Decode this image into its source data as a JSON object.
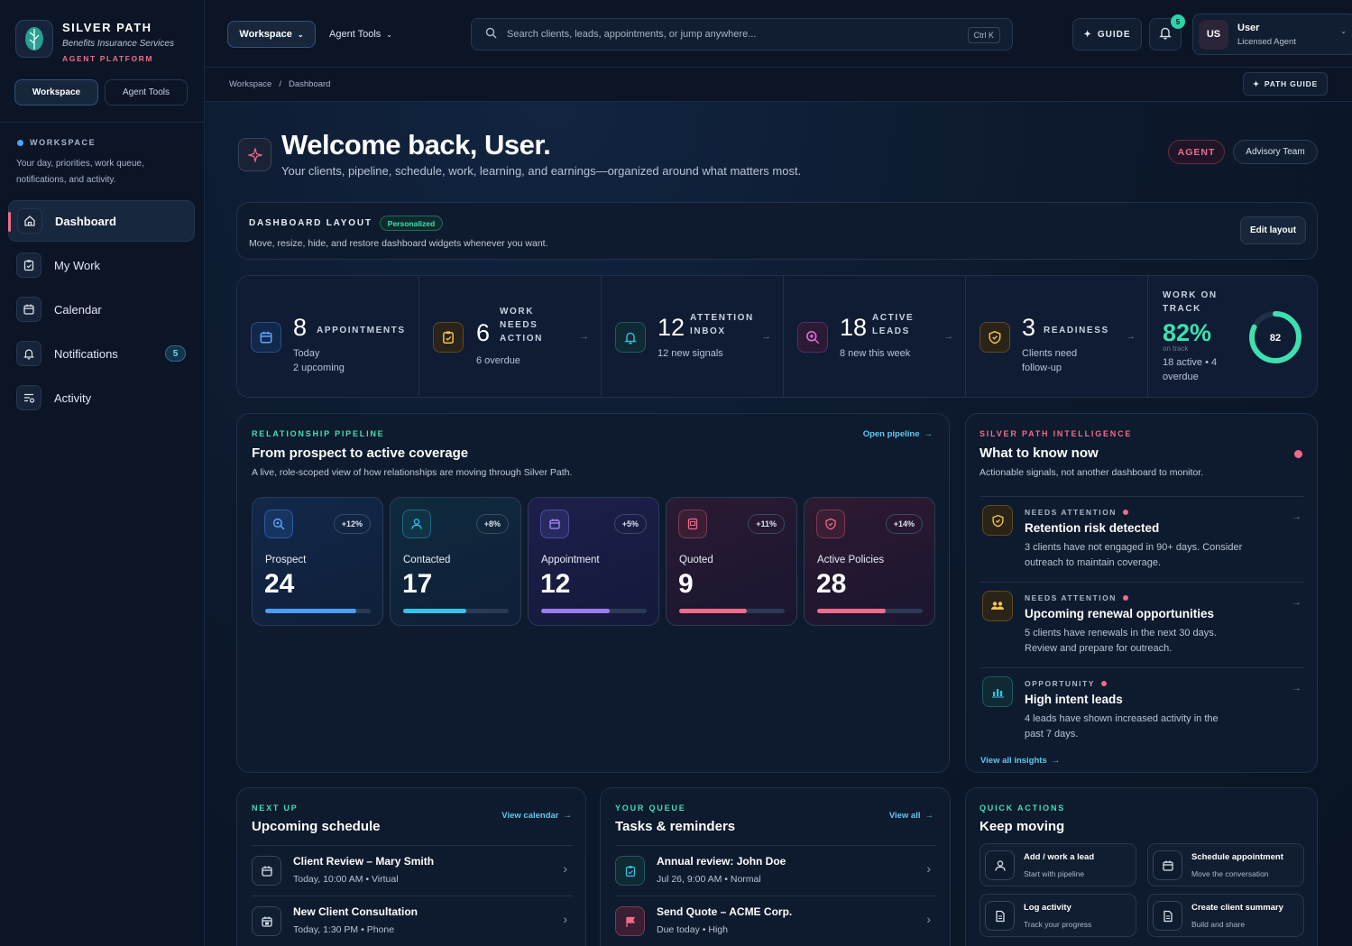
{
  "brand": {
    "name": "SILVER PATH",
    "tagline": "Benefits Insurance Services",
    "platform": "AGENT PLATFORM"
  },
  "sidebar": {
    "tabs": [
      {
        "label": "Workspace"
      },
      {
        "label": "Agent Tools"
      }
    ],
    "section_title": "WORKSPACE",
    "section_desc": "Your day, priorities, work queue, notifications, and activity.",
    "items": [
      {
        "label": "Dashboard",
        "icon": "home-icon"
      },
      {
        "label": "My Work",
        "icon": "clipboard-icon"
      },
      {
        "label": "Calendar",
        "icon": "calendar-icon"
      },
      {
        "label": "Notifications",
        "icon": "bell-icon",
        "badge": "5"
      },
      {
        "label": "Activity",
        "icon": "activity-icon"
      }
    ]
  },
  "topbar": {
    "workspace_label": "Workspace",
    "agent_tools_label": "Agent Tools",
    "search_placeholder": "Search clients, leads, appointments, or jump anywhere...",
    "search_shortcut": "Ctrl K",
    "guide_label": "GUIDE",
    "notif_count": "5",
    "user": {
      "initials": "US",
      "name": "User",
      "role": "Licensed Agent"
    }
  },
  "breadcrumb": {
    "root": "Workspace",
    "sep": "/",
    "current": "Dashboard",
    "path_guide": "PATH GUIDE"
  },
  "welcome": {
    "title": "Welcome back, User.",
    "subtitle": "Your clients, pipeline, schedule, work, learning, and earnings—organized around what matters most.",
    "tag_agent": "AGENT",
    "tag_team": "Advisory Team"
  },
  "layout_panel": {
    "title": "DASHBOARD LAYOUT",
    "badge": "Personalized",
    "desc": "Move, resize, hide, and restore dashboard widgets whenever you want.",
    "edit": "Edit layout"
  },
  "stats": [
    {
      "num": "8",
      "label": "APPOINTMENTS",
      "sub1": "Today",
      "sub2": "2 upcoming"
    },
    {
      "num": "6",
      "label": "WORK NEEDS ACTION",
      "sub1": "6 overdue"
    },
    {
      "num": "12",
      "label": "ATTENTION INBOX",
      "sub1": "12 new signals"
    },
    {
      "num": "18",
      "label": "ACTIVE LEADS",
      "sub1": "8 new this week"
    },
    {
      "num": "3",
      "label": "READINESS",
      "sub1": "Clients need follow-up"
    },
    {
      "label": "WORK ON TRACK",
      "pct": "82%",
      "pct_sub": "on track",
      "sub1": "18 active • 4 overdue",
      "ring": "82",
      "ring_value": 0.82
    }
  ],
  "pipeline": {
    "kicker": "RELATIONSHIP PIPELINE",
    "title": "From prospect to active coverage",
    "desc": "A live, role-scoped view of how relationships are moving through Silver Path.",
    "link": "Open pipeline",
    "stages": [
      {
        "label": "Prospect",
        "count": "24",
        "change": "+12%",
        "progress": 0.86,
        "color": "#4a9dff"
      },
      {
        "label": "Contacted",
        "count": "17",
        "change": "+8%",
        "progress": 0.6,
        "color": "#34c3e8"
      },
      {
        "label": "Appointment",
        "count": "12",
        "change": "+5%",
        "progress": 0.65,
        "color": "#9b7bf0"
      },
      {
        "label": "Quoted",
        "count": "9",
        "change": "+11%",
        "progress": 0.64,
        "color": "#f06b8a"
      },
      {
        "label": "Active Policies",
        "count": "28",
        "change": "+14%",
        "progress": 0.65,
        "color": "#f06b8a"
      }
    ]
  },
  "intelligence": {
    "kicker": "SILVER PATH INTELLIGENCE",
    "title": "What to know now",
    "desc": "Actionable signals, not another dashboard to monitor.",
    "items": [
      {
        "kicker": "NEEDS ATTENTION",
        "title": "Retention risk detected",
        "desc": "3 clients have not engaged in 90+ days. Consider outreach to maintain coverage."
      },
      {
        "kicker": "NEEDS ATTENTION",
        "title": "Upcoming renewal opportunities",
        "desc": "5 clients have renewals in the next 30 days. Review and prepare for outreach."
      },
      {
        "kicker": "OPPORTUNITY",
        "title": "High intent leads",
        "desc": "4 leads have shown increased activity in the past 7 days."
      }
    ],
    "link": "View all insights"
  },
  "schedule": {
    "kicker": "NEXT UP",
    "title": "Upcoming schedule",
    "link": "View calendar",
    "items": [
      {
        "title": "Client Review – Mary Smith",
        "sub": "Today, 10:00 AM  •  Virtual"
      },
      {
        "title": "New Client Consultation",
        "sub": "Today, 1:30 PM  •  Phone"
      }
    ]
  },
  "queue": {
    "kicker": "YOUR QUEUE",
    "title": "Tasks & reminders",
    "link": "View all",
    "items": [
      {
        "title": "Annual review: John Doe",
        "sub": "Jul 26, 9:00 AM  •  Normal"
      },
      {
        "title": "Send Quote – ACME Corp.",
        "sub": "Due today  •  High"
      }
    ]
  },
  "quick": {
    "kicker": "QUICK ACTIONS",
    "title": "Keep moving",
    "items": [
      {
        "title": "Add / work a lead",
        "sub": "Start with pipeline"
      },
      {
        "title": "Schedule appointment",
        "sub": "Move the conversation"
      },
      {
        "title": "Log activity",
        "sub": "Track your progress"
      },
      {
        "title": "Create client summary",
        "sub": "Build and share"
      }
    ]
  }
}
